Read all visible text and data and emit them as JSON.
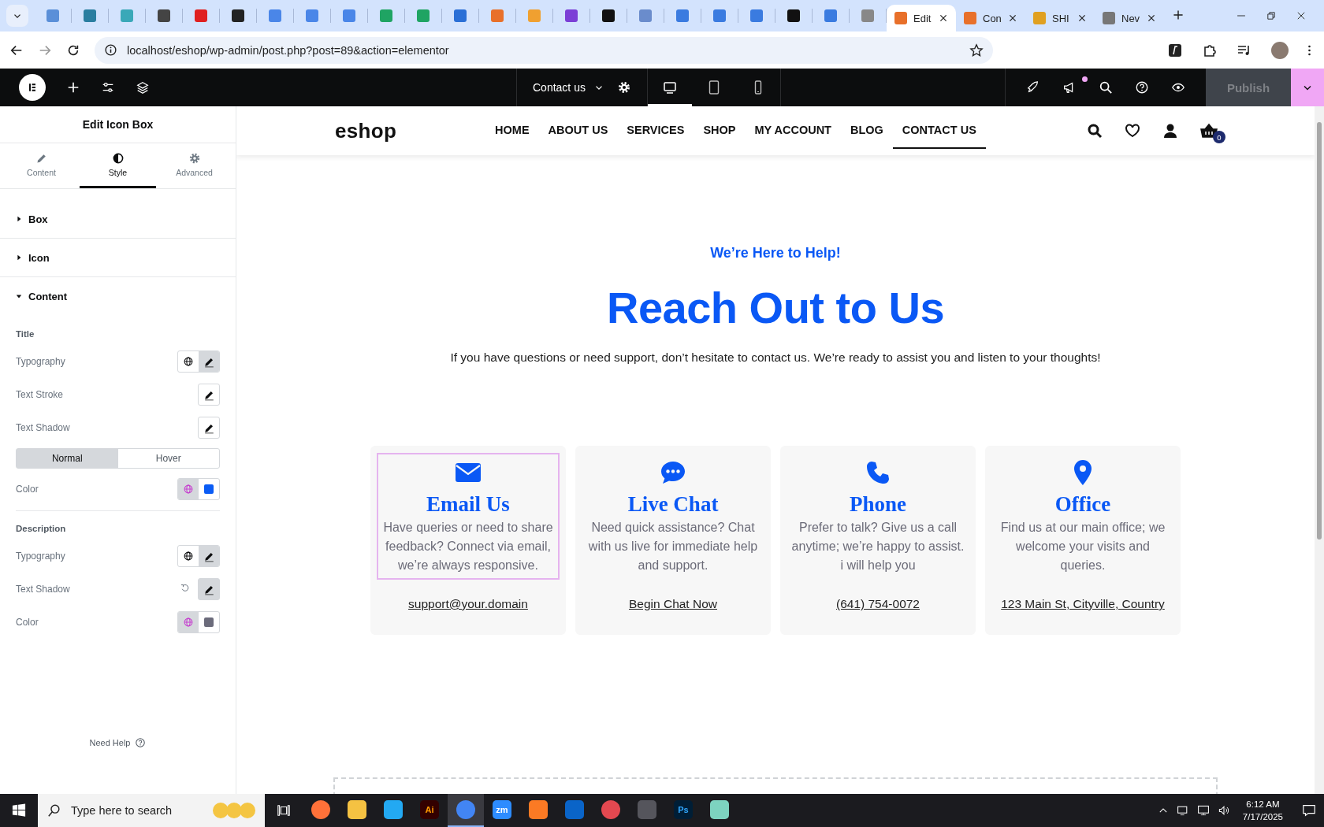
{
  "browser": {
    "tabs": [
      {
        "label": "Edit",
        "selected": true
      },
      {
        "label": "Con",
        "selected": false
      },
      {
        "label": "SHI",
        "selected": false
      },
      {
        "label": "Nev",
        "selected": false
      }
    ],
    "url": "localhost/eshop/wp-admin/post.php?post=89&action=elementor"
  },
  "editor_bar": {
    "page": "Contact us",
    "notification": true,
    "devices": [
      {
        "kind": "desktop",
        "selected": true
      },
      {
        "kind": "tablet",
        "selected": false
      },
      {
        "kind": "mobile",
        "selected": false
      }
    ],
    "publish": {
      "label": "Publish",
      "disabled": true
    }
  },
  "panel": {
    "title": "Edit Icon Box",
    "tabs": [
      {
        "kind": "pencil",
        "label": "Content",
        "selected": false
      },
      {
        "kind": "contrast",
        "label": "Style",
        "selected": true
      },
      {
        "kind": "gear",
        "label": "Advanced",
        "selected": false
      }
    ],
    "sections": [
      {
        "label": "Box",
        "expanded": false
      },
      {
        "label": "Icon",
        "expanded": false
      },
      {
        "label": "Content",
        "expanded": true
      }
    ],
    "groups": [
      {
        "heading": "Title",
        "controls": [
          {
            "kind": "typography",
            "label": "Typography"
          },
          {
            "kind": "edit",
            "label": "Text Stroke"
          },
          {
            "kind": "edit",
            "label": "Text Shadow"
          },
          {
            "kind": "toggle",
            "options": [
              {
                "label": "Normal",
                "selected": true
              },
              {
                "label": "Hover",
                "selected": false
              }
            ]
          },
          {
            "kind": "color",
            "label": "Color",
            "color": "#0a5cf5"
          }
        ]
      },
      {
        "heading": "Description",
        "controls": [
          {
            "kind": "typography",
            "label": "Typography"
          },
          {
            "kind": "reset",
            "label": "Text Shadow"
          },
          {
            "kind": "color",
            "label": "Color",
            "color": "#6b6b7b"
          }
        ]
      }
    ],
    "help": "Need Help"
  },
  "site": {
    "logo": "eshop",
    "nav": [
      {
        "label": "HOME",
        "selected": false
      },
      {
        "label": "ABOUT US",
        "selected": false
      },
      {
        "label": "SERVICES",
        "selected": false
      },
      {
        "label": "SHOP",
        "selected": false
      },
      {
        "label": "MY ACCOUNT",
        "selected": false
      },
      {
        "label": "BLOG",
        "selected": false
      },
      {
        "label": "CONTACT US",
        "selected": true
      }
    ],
    "cart_count": "0",
    "tagline": "We’re Here to Help!",
    "heading": "Reach Out to Us",
    "intro": "If you have questions or need support, don’t hesitate to contact us. We’re ready to assist you and listen to your thoughts!",
    "cards": [
      {
        "kind": "email",
        "title": "Email Us",
        "description": "Have queries or need to share feedback? Connect via email, we’re always responsive.",
        "link": "support@your.domain",
        "selected": true
      },
      {
        "kind": "chat",
        "title": "Live Chat",
        "description": "Need quick assistance? Chat with us live for immediate help and support.",
        "link": "Begin Chat Now",
        "selected": false
      },
      {
        "kind": "phone",
        "title": "Phone",
        "description": "Prefer to talk? Give us a call anytime; we’re happy to assist. i will help you",
        "link": "(641) 754-0072",
        "selected": false
      },
      {
        "kind": "office",
        "title": "Office",
        "description": "Find us at our main office; we welcome your visits and queries.",
        "link": "123 Main St, Cityville, Country",
        "selected": false
      }
    ]
  },
  "taskbar": {
    "search_placeholder": "Type here to search",
    "apps": [
      {
        "kind": "firefox",
        "active": false
      },
      {
        "kind": "files",
        "active": false
      },
      {
        "kind": "code",
        "active": false
      },
      {
        "kind": "illustrator",
        "label": "Ai",
        "active": false
      },
      {
        "kind": "chrome",
        "active": true
      },
      {
        "kind": "zoom",
        "label": "zm",
        "active": false
      },
      {
        "kind": "xampp",
        "active": false
      },
      {
        "kind": "outlook",
        "active": false
      },
      {
        "kind": "cloud",
        "active": false
      },
      {
        "kind": "pen",
        "active": false
      },
      {
        "kind": "photoshop",
        "label": "Ps",
        "active": false
      },
      {
        "kind": "gem",
        "active": false
      }
    ],
    "time": "6:12 AM",
    "date": "7/17/2025"
  }
}
